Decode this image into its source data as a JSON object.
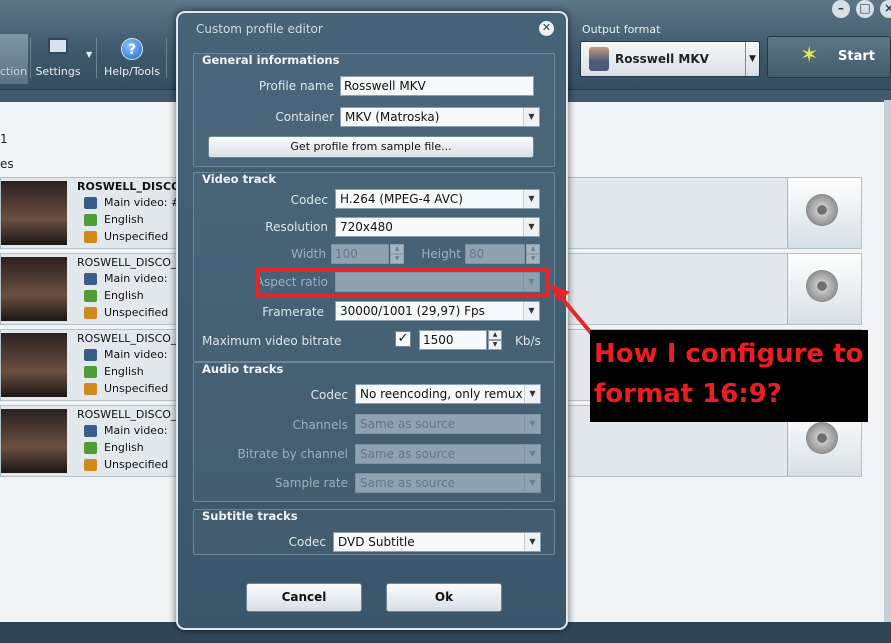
{
  "app": {
    "toolbar": {
      "action_label": "ction",
      "settings_label": "Settings",
      "help_label": "Help/Tools"
    },
    "output_format": {
      "label": "Output format",
      "value": "Rosswell MKV"
    },
    "start_label": "Start",
    "info_lines": [
      "1",
      "es"
    ],
    "titles": [
      {
        "name": "ROSWELL_DISCO_",
        "video": "Main video: #1",
        "audio": "English",
        "subtitle": "Unspecified"
      },
      {
        "name": "ROSWELL_DISCO_1",
        "video": "Main video:",
        "audio": "English",
        "subtitle": "Unspecified"
      },
      {
        "name": "ROSWELL_DISCO_1",
        "video": "Main video:",
        "audio": "English",
        "subtitle": "Unspecified"
      },
      {
        "name": "ROSWELL_DISCO_1",
        "video": "Main video:",
        "audio": "English",
        "subtitle": "Unspecified"
      }
    ]
  },
  "dialog": {
    "title": "Custom profile editor",
    "close_glyph": "✕",
    "general": {
      "title": "General informations",
      "profile_name_label": "Profile name",
      "profile_name_value": "Rosswell MKV",
      "container_label": "Container",
      "container_value": "MKV (Matroska)",
      "sample_button": "Get profile from sample file..."
    },
    "video": {
      "title": "Video track",
      "codec_label": "Codec",
      "codec_value": "H.264 (MPEG-4 AVC)",
      "resolution_label": "Resolution",
      "resolution_value": "720x480",
      "width_label": "Width",
      "width_value": "100",
      "height_label": "Height",
      "height_value": "80",
      "aspect_label": "Aspect ratio",
      "aspect_value": "",
      "framerate_label": "Framerate",
      "framerate_value": "30000/1001 (29,97) Fps",
      "bitrate_label": "Maximum video bitrate",
      "bitrate_checked": "✓",
      "bitrate_value": "1500",
      "bitrate_unit": "Kb/s"
    },
    "audio": {
      "title": "Audio tracks",
      "codec_label": "Codec",
      "codec_value": "No reencoding, only remux",
      "channels_label": "Channels",
      "channels_value": "Same as source",
      "bitrate_label": "Bitrate by channel",
      "bitrate_value": "Same as source",
      "samplerate_label": "Sample rate",
      "samplerate_value": "Same as source"
    },
    "subtitle": {
      "title": "Subtitle tracks",
      "codec_label": "Codec",
      "codec_value": "DVD Subtitle"
    },
    "cancel_label": "Cancel",
    "ok_label": "Ok"
  },
  "annotation": {
    "text": "How I configure to format 16:9?",
    "color": "#ea1d24"
  }
}
